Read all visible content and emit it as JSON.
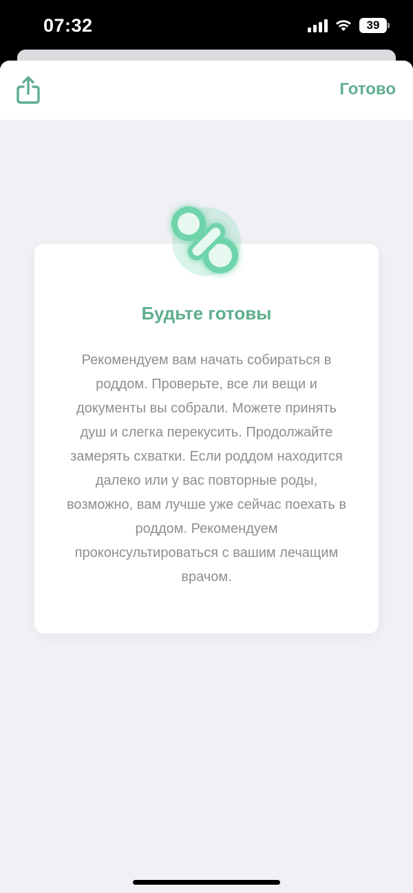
{
  "status_bar": {
    "time": "07:32",
    "battery": "39",
    "icons": [
      "signal-icon",
      "wifi-icon",
      "battery-icon"
    ]
  },
  "nav": {
    "share_icon": "share-icon",
    "done_label": "Готово"
  },
  "card": {
    "icon": "pacifier-icon",
    "title": "Будьте готовы",
    "text": "Рекомендуем вам начать собираться в роддом. Проверьте, все ли вещи и документы вы собрали. Можете принять душ и слегка перекусить. Продолжайте замерять схватки. Если роддом находится далеко или у вас повторные роды, возможно, вам лучше уже сейчас поехать в роддом. Рекомендуем проконсультироваться с вашим лечащим врачом."
  },
  "colors": {
    "accent": "#5fae8e",
    "accent_light": "#6fd4aa",
    "background": "#f0f0f5",
    "card": "#ffffff",
    "body_text": "#8e8e93"
  }
}
